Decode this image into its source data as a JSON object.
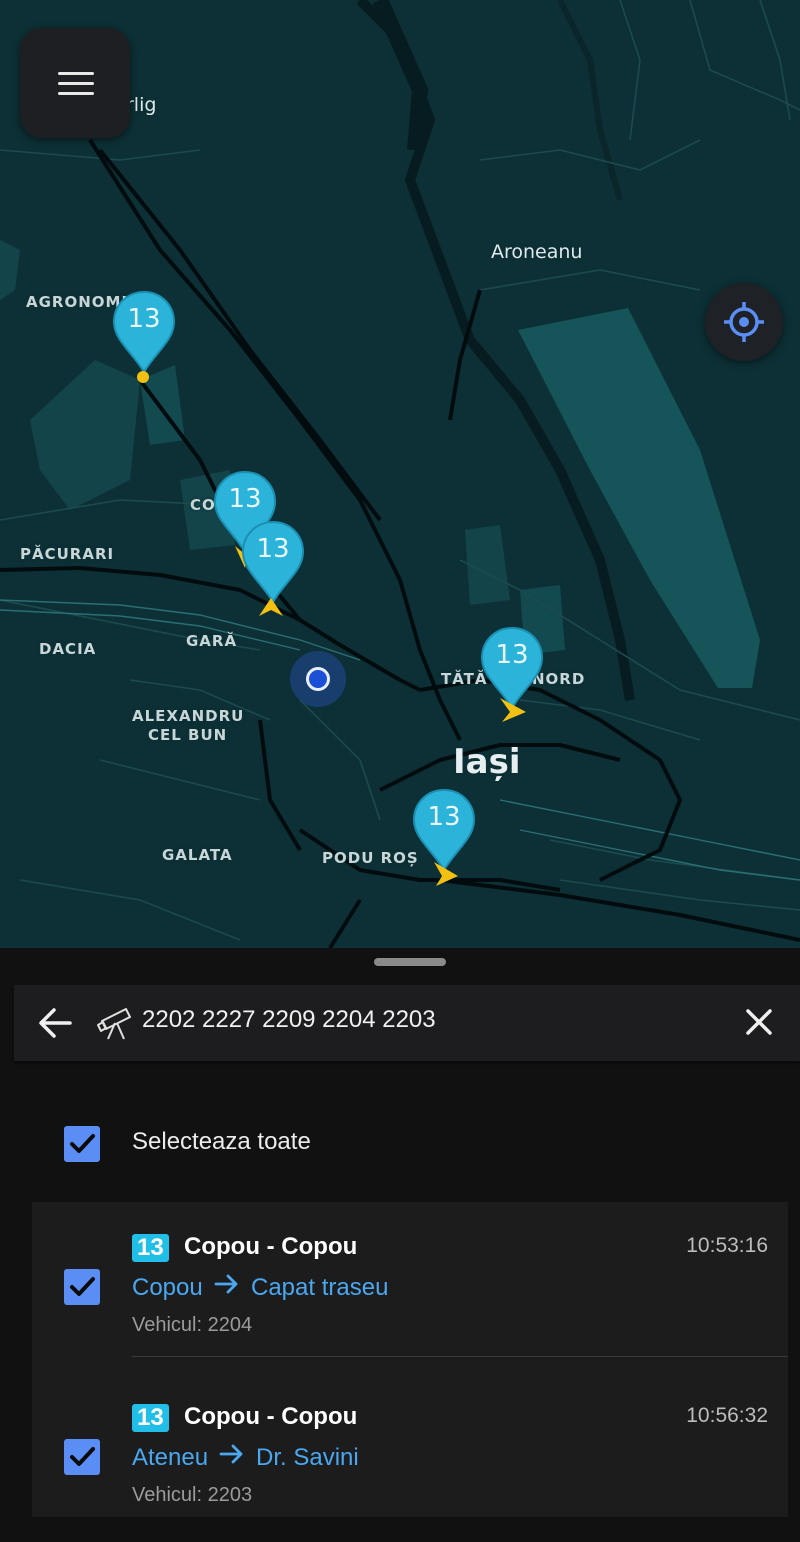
{
  "map": {
    "labels": {
      "place_top": "rlig",
      "aroneanu": "Aroneanu",
      "agronomia": "AGRONOMI",
      "copou_short": "CO",
      "pacurari": "PĂCURARI",
      "dacia": "DACIA",
      "gara": "GARĂ",
      "alexandru1": "ALEXANDRU",
      "alexandru2": "CEL BUN",
      "tatarasi": "TĂTĂ",
      "nord": "NORD",
      "iasi": "Iași",
      "galata": "GALATA",
      "podu_ros": "PODU ROȘ"
    },
    "vehicle_pins": [
      {
        "label": "13",
        "color": "#2bb3d9"
      },
      {
        "label": "13",
        "color": "#2bb3d9"
      },
      {
        "label": "13",
        "color": "#2bb3d9"
      },
      {
        "label": "13",
        "color": "#2bb3d9"
      },
      {
        "label": "13",
        "color": "#2bb3d9"
      }
    ],
    "icons": {
      "menu": "hamburger-menu-icon",
      "locate": "crosshair-locate-icon",
      "user": "user-location-dot"
    }
  },
  "search": {
    "query": "2202 2227 2209 2204 2203",
    "icons": {
      "back": "back-arrow-icon",
      "telescope": "telescope-icon",
      "clear": "close-icon"
    }
  },
  "select_all": {
    "label": "Selecteaza toate",
    "checked": true
  },
  "vehicles": [
    {
      "line": "13",
      "route": "Copou - Copou",
      "time": "10:53:16",
      "from": "Copou",
      "to": "Capat traseu",
      "vehicle": "Vehicul: 2204",
      "checked": true
    },
    {
      "line": "13",
      "route": "Copou - Copou",
      "time": "10:56:32",
      "from": "Ateneu",
      "to": "Dr. Savini",
      "vehicle": "Vehicul: 2203",
      "checked": true
    }
  ],
  "colors": {
    "accent": "#5b8ef5",
    "line_badge": "#21bfe7",
    "link": "#4aa7f0",
    "map_bg": "#0c3035"
  }
}
